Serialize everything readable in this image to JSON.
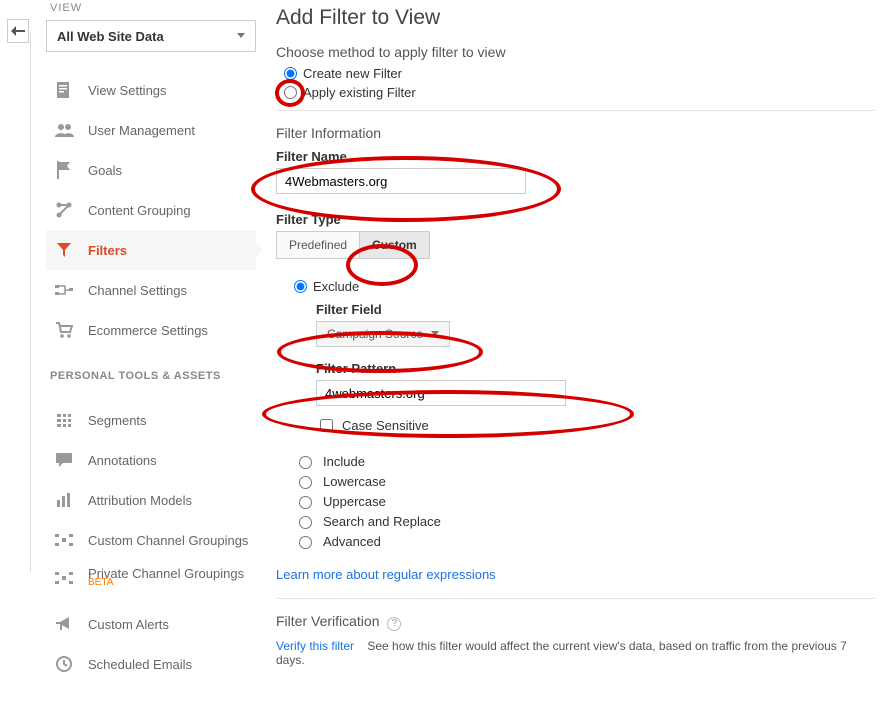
{
  "sidebar": {
    "viewLabel": "VIEW",
    "viewSelected": "All Web Site Data",
    "nav": [
      {
        "label": "View Settings"
      },
      {
        "label": "User Management"
      },
      {
        "label": "Goals"
      },
      {
        "label": "Content Grouping"
      },
      {
        "label": "Filters"
      },
      {
        "label": "Channel Settings"
      },
      {
        "label": "Ecommerce Settings"
      }
    ],
    "toolsLabel": "PERSONAL TOOLS & ASSETS",
    "tools": [
      {
        "label": "Segments"
      },
      {
        "label": "Annotations"
      },
      {
        "label": "Attribution Models"
      },
      {
        "label": "Custom Channel Groupings"
      },
      {
        "label": "Private Channel Groupings",
        "badge": "BETA"
      },
      {
        "label": "Custom Alerts"
      },
      {
        "label": "Scheduled Emails"
      }
    ]
  },
  "main": {
    "title": "Add Filter to View",
    "methodLabel": "Choose method to apply filter to view",
    "methodOptions": {
      "create": "Create new Filter",
      "existing": "Apply existing Filter"
    },
    "infoLabel": "Filter Information",
    "filterNameLabel": "Filter Name",
    "filterNameValue": "4Webmasters.org",
    "filterTypeLabel": "Filter Type",
    "tabs": {
      "predefined": "Predefined",
      "custom": "Custom"
    },
    "exclude": "Exclude",
    "filterFieldLabel": "Filter Field",
    "filterFieldSelected": "Campaign Source",
    "filterPatternLabel": "Filter Pattern",
    "filterPatternValue": "4webmasters.org",
    "caseSensitive": "Case Sensitive",
    "extraOptions": [
      "Include",
      "Lowercase",
      "Uppercase",
      "Search and Replace",
      "Advanced"
    ],
    "regexLink": "Learn more about regular expressions",
    "verificationLabel": "Filter Verification",
    "verifyLink": "Verify this filter",
    "verifyDesc": "See how this filter would affect the current view's data, based on traffic from the previous 7 days."
  }
}
